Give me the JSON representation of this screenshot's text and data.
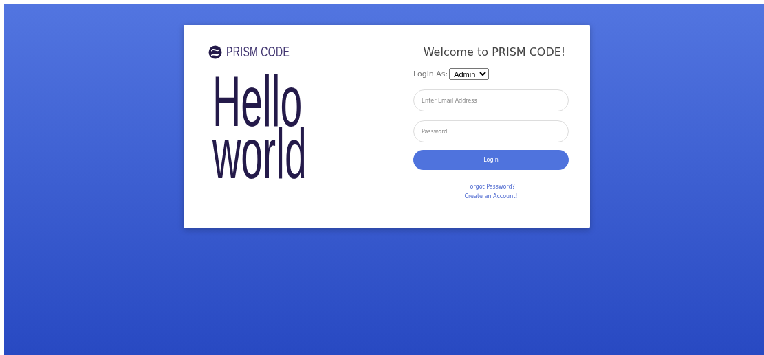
{
  "brand": {
    "name": "PRISM CODE"
  },
  "hero": {
    "lines": [
      "Hello",
      "world"
    ]
  },
  "form": {
    "title": "Welcome to PRISM CODE!",
    "role_label": "Login As:",
    "role_value": "Admin",
    "email": {
      "placeholder": "Enter Email Address"
    },
    "password": {
      "placeholder": "Password"
    },
    "submit": "Login",
    "links": [
      "Forgot Password?",
      "Create an Account!"
    ]
  }
}
